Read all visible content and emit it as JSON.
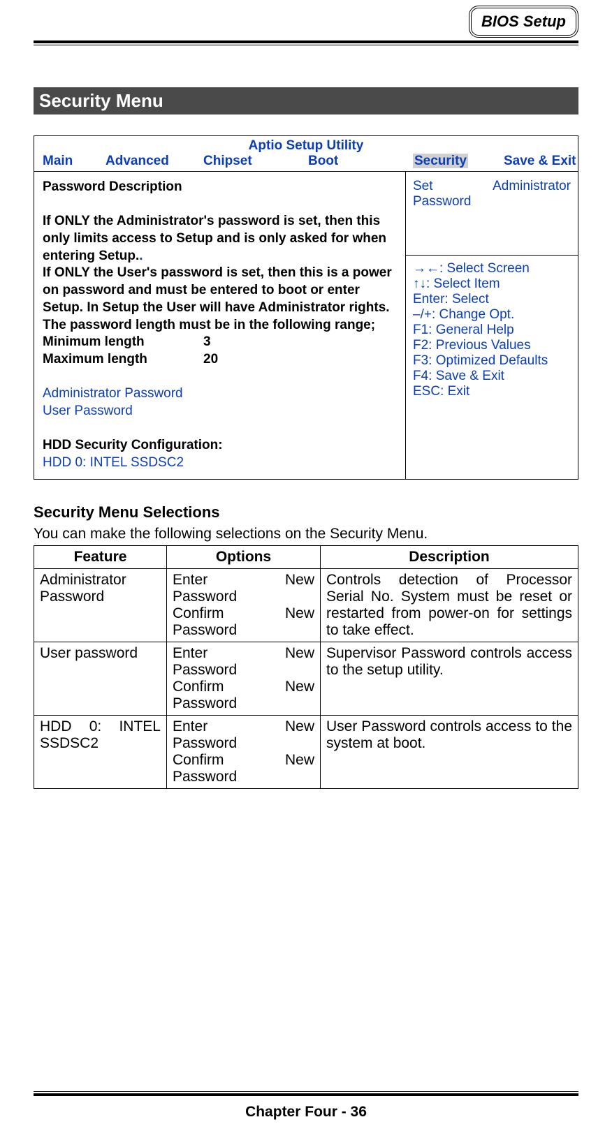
{
  "header": {
    "badge": "BIOS Setup"
  },
  "section_title": "Security Menu",
  "bios": {
    "title": "Aptio Setup Utility",
    "tabs": {
      "main": "Main",
      "advanced": "Advanced",
      "chipset": "Chipset",
      "boot": "Boot",
      "security": "Security",
      "save_exit": "Save & Exit"
    },
    "left": {
      "pw_desc_title": "Password Description",
      "admin_desc": "If ONLY the Administrator's password is set, then this only limits access to Setup and is only asked for when entering Setup.",
      "user_desc": "If ONLY the User's password is set, then this is a power on password and must be entered to boot or enter Setup. In Setup the User will have Administrator rights.",
      "len_intro": "The password length must be in the following range;",
      "min_label": "Minimum length",
      "min_val": "3",
      "max_label": "Maximum length",
      "max_val": "20",
      "admin_pw": "Administrator Password",
      "user_pw": "User Password",
      "hdd_title": "HDD Security Configuration:",
      "hdd_item": "HDD 0: INTEL SSDSC2"
    },
    "help": {
      "top_left": "Set",
      "top_right": "Administrator",
      "top_line2": "Password",
      "lines": [
        "→←: Select Screen",
        "↑↓: Select Item",
        "Enter: Select",
        "–/+: Change Opt.",
        "F1: General Help",
        "F2: Previous Values",
        "F3: Optimized Defaults",
        "F4: Save & Exit",
        "ESC: Exit"
      ]
    }
  },
  "selections": {
    "title": "Security Menu Selections",
    "intro": "You can make the following selections on the Security Menu.",
    "headers": {
      "feature": "Feature",
      "options": "Options",
      "description": "Description"
    },
    "rows": [
      {
        "feature": "Administrator Password",
        "opt1a": "Enter",
        "opt1b": "New",
        "opt1c": "Password",
        "opt2a": "Confirm",
        "opt2b": "New",
        "opt2c": "Password",
        "desc": "Controls detection of Processor Serial No. System must be reset or restarted from power-on for settings to take effect."
      },
      {
        "feature": "User password",
        "opt1a": "Enter",
        "opt1b": "New",
        "opt1c": "Password",
        "opt2a": "Confirm",
        "opt2b": "New",
        "opt2c": "Password",
        "desc": "Supervisor Password controls access to the setup utility."
      },
      {
        "feature": "HDD 0: INTEL SSDSC2",
        "opt1a": "Enter",
        "opt1b": "New",
        "opt1c": "Password",
        "opt2a": "Confirm",
        "opt2b": "New",
        "opt2c": "Password",
        "desc": "User Password controls access to the system at boot."
      }
    ]
  },
  "footer": "Chapter Four - 36"
}
